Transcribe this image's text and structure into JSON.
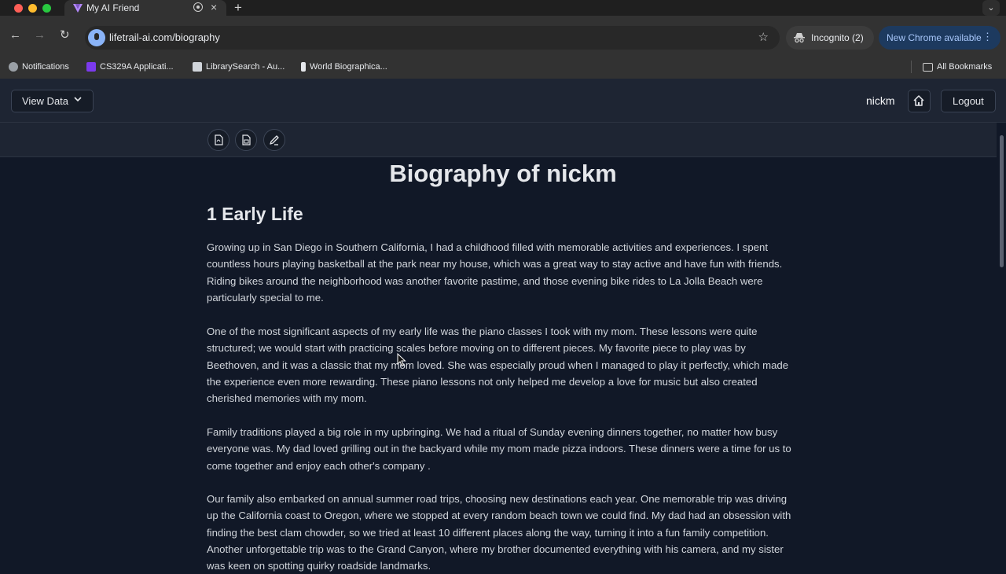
{
  "browser": {
    "tab_title": "My AI Friend",
    "url": "lifetrail-ai.com/biography",
    "incognito_label": "Incognito (2)",
    "update_label": "New Chrome available",
    "bookmarks": [
      {
        "label": "Notifications",
        "icon": "globe-icon"
      },
      {
        "label": "CS329A Applicati...",
        "icon": "grid-icon"
      },
      {
        "label": "LibrarySearch - Au...",
        "icon": "book-icon"
      },
      {
        "label": "World Biographica...",
        "icon": "page-icon"
      }
    ],
    "all_bookmarks_label": "All Bookmarks"
  },
  "header": {
    "view_data_label": "View Data",
    "username": "nickm",
    "logout_label": "Logout"
  },
  "toolbar": {
    "icons": [
      "pdf-export-icon",
      "doc-export-icon",
      "edit-icon"
    ]
  },
  "document": {
    "title": "Biography of nickm",
    "section_title": "1 Early Life",
    "paragraphs": [
      "Growing up in San Diego in Southern California, I had a childhood filled with memorable activities and experiences. I spent countless hours playing basketball at the park near my house, which was a great way to stay active and have fun with friends. Riding bikes around the neighborhood was another favorite pastime, and those evening bike rides to La Jolla Beach were particularly special to me.",
      "One of the most significant aspects of my early life was the piano classes I took with my mom. These lessons were quite structured; we would start with practicing scales before moving on to different pieces. My favorite piece to play was by Beethoven, and it was a classic that my mom loved. She was especially proud when I managed to play it perfectly, which made the experience even more rewarding. These piano lessons not only helped me develop a love for music but also created cherished memories with my mom.",
      "Family traditions played a big role in my upbringing. We had a ritual of Sunday evening dinners together, no matter how busy everyone was. My dad loved grilling out in the backyard while my mom made pizza indoors. These dinners were a time for us to come together and enjoy each other's company .",
      "Our family also embarked on annual summer road trips, choosing new destinations each year. One memorable trip was driving up the California coast to Oregon, where we stopped at every random beach town we could find. My dad had an obsession with finding the best clam chowder, so we tried at least 10 different places along the way, turning it into a fun family competition. Another unforgettable trip was to the Grand Canyon, where my brother documented everything with his camera, and my sister was keen on spotting quirky roadside landmarks."
    ]
  },
  "colors": {
    "page_bg": "#111827",
    "header_bg": "#1e2533",
    "text": "#d1d5db",
    "chrome_accent": "#a8c7fa"
  }
}
